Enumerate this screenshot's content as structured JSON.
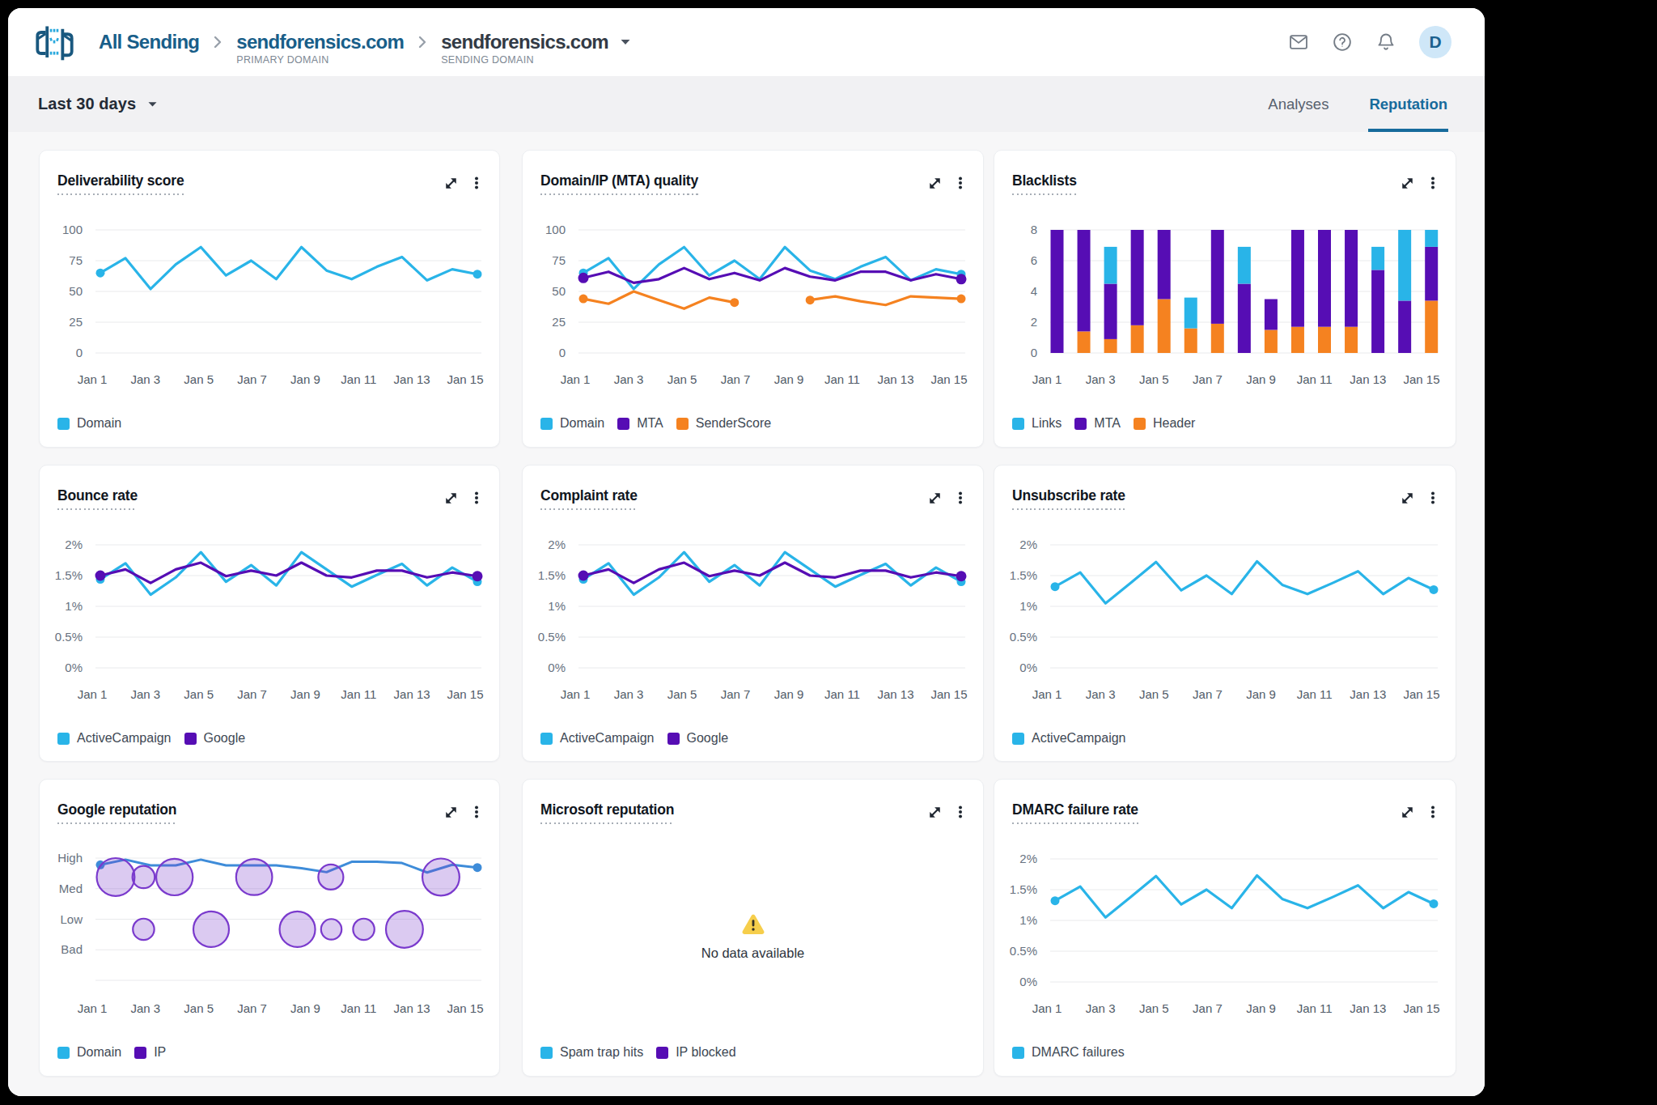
{
  "header": {
    "breadcrumb": [
      {
        "label": "All Sending",
        "sublabel": ""
      },
      {
        "label": "sendforensics.com",
        "sublabel": "PRIMARY DOMAIN"
      },
      {
        "label": "sendforensics.com",
        "sublabel": "SENDING DOMAIN"
      }
    ],
    "avatar_letter": "D"
  },
  "toolbar": {
    "date_range_label": "Last 30 days",
    "tabs": [
      {
        "label": "Analyses",
        "active": false
      },
      {
        "label": "Reputation",
        "active": true
      }
    ]
  },
  "colors": {
    "cyan": "#29B4E8",
    "purple": "#560DB4",
    "orange": "#F58220",
    "blue": "#3E8CD9",
    "bubble_stroke": "#7A3ACD",
    "brand_dark": "#185E89",
    "brand_light": "#29A9DE",
    "warn_yellow": "#F6CE4B",
    "warn_dark": "#353025",
    "tab_active": "#176B9C"
  },
  "x_tick_labels": [
    "Jan 1",
    "Jan 3",
    "Jan 5",
    "Jan 7",
    "Jan 9",
    "Jan 11",
    "Jan 13",
    "Jan 15"
  ],
  "chart_data": [
    {
      "title": "Deliverability score",
      "type": "line",
      "y_ticks": [
        "100",
        "75",
        "50",
        "25",
        "0"
      ],
      "y_max": 100,
      "series": [
        {
          "name": "Domain",
          "color": "cyan",
          "markers": "ends",
          "values": [
            65,
            77,
            52,
            72,
            86,
            63,
            75,
            60,
            86,
            67,
            60,
            70,
            78,
            59,
            68,
            64
          ]
        }
      ],
      "legend": [
        {
          "label": "Domain",
          "color": "cyan"
        }
      ]
    },
    {
      "title": "Domain/IP (MTA) quality",
      "type": "line",
      "y_ticks": [
        "100",
        "75",
        "50",
        "25",
        "0"
      ],
      "y_max": 100,
      "series": [
        {
          "name": "Domain",
          "color": "cyan",
          "markers": "ends",
          "values": [
            65,
            77,
            52,
            72,
            86,
            63,
            75,
            60,
            86,
            67,
            60,
            70,
            78,
            59,
            68,
            64
          ]
        },
        {
          "name": "MTA",
          "color": "purple",
          "markers": "ends",
          "values": [
            61,
            66,
            57,
            60,
            69,
            60,
            65,
            59,
            69,
            62,
            59,
            66,
            66,
            59,
            64,
            60
          ]
        },
        {
          "name": "SenderScore",
          "color": "orange",
          "markers": "segment-ends",
          "values": [
            44,
            40,
            50,
            43,
            36,
            45,
            41,
            null,
            null,
            43,
            46,
            42,
            39,
            46,
            45,
            44
          ]
        }
      ],
      "legend": [
        {
          "label": "Domain",
          "color": "cyan"
        },
        {
          "label": "MTA",
          "color": "purple"
        },
        {
          "label": "SenderScore",
          "color": "orange"
        }
      ]
    },
    {
      "title": "Blacklists",
      "type": "stacked-bar",
      "y_ticks": [
        "8",
        "6",
        "4",
        "2",
        "0"
      ],
      "y_max": 8,
      "stacks": [
        {
          "name": "Header",
          "color": "orange",
          "values": [
            0,
            1.4,
            0.9,
            1.8,
            3.5,
            1.6,
            1.9,
            0,
            1.5,
            1.7,
            1.7,
            1.7,
            0,
            0,
            3.4
          ]
        },
        {
          "name": "MTA",
          "color": "purple",
          "values": [
            8,
            6.6,
            3.6,
            6.2,
            4.5,
            0,
            6.1,
            4.5,
            2.0,
            6.3,
            6.3,
            6.3,
            5.4,
            3.4,
            3.5
          ]
        },
        {
          "name": "Links",
          "color": "cyan",
          "values": [
            0,
            0,
            2.4,
            0,
            0,
            2.0,
            0,
            2.4,
            0,
            0,
            0,
            0,
            1.5,
            4.6,
            1.1
          ]
        }
      ],
      "legend": [
        {
          "label": "Links",
          "color": "cyan"
        },
        {
          "label": "MTA",
          "color": "purple"
        },
        {
          "label": "Header",
          "color": "orange"
        }
      ]
    },
    {
      "title": "Bounce rate",
      "type": "line",
      "y_ticks": [
        "2%",
        "1.5%",
        "1%",
        "0.5%",
        "0%"
      ],
      "y_max": 2,
      "series": [
        {
          "name": "ActiveCampaign",
          "color": "cyan",
          "markers": "ends",
          "values": [
            1.44,
            1.7,
            1.19,
            1.47,
            1.88,
            1.4,
            1.67,
            1.34,
            1.88,
            1.6,
            1.32,
            1.51,
            1.69,
            1.34,
            1.63,
            1.4
          ]
        },
        {
          "name": "Google",
          "color": "purple",
          "markers": "ends",
          "values": [
            1.5,
            1.6,
            1.38,
            1.6,
            1.71,
            1.49,
            1.58,
            1.5,
            1.71,
            1.5,
            1.47,
            1.58,
            1.58,
            1.47,
            1.55,
            1.49
          ]
        }
      ],
      "legend": [
        {
          "label": "ActiveCampaign",
          "color": "cyan"
        },
        {
          "label": "Google",
          "color": "purple"
        }
      ]
    },
    {
      "title": "Complaint rate",
      "type": "line",
      "y_ticks": [
        "2%",
        "1.5%",
        "1%",
        "0.5%",
        "0%"
      ],
      "y_max": 2,
      "series": [
        {
          "name": "ActiveCampaign",
          "color": "cyan",
          "markers": "ends",
          "values": [
            1.44,
            1.7,
            1.19,
            1.47,
            1.88,
            1.4,
            1.67,
            1.34,
            1.88,
            1.6,
            1.32,
            1.51,
            1.69,
            1.34,
            1.63,
            1.4
          ]
        },
        {
          "name": "Google",
          "color": "purple",
          "markers": "ends",
          "values": [
            1.5,
            1.6,
            1.38,
            1.6,
            1.71,
            1.49,
            1.58,
            1.5,
            1.71,
            1.5,
            1.47,
            1.58,
            1.58,
            1.47,
            1.55,
            1.49
          ]
        }
      ],
      "legend": [
        {
          "label": "ActiveCampaign",
          "color": "cyan"
        },
        {
          "label": "Google",
          "color": "purple"
        }
      ]
    },
    {
      "title": "Unsubscribe rate",
      "type": "line",
      "y_ticks": [
        "2%",
        "1.5%",
        "1%",
        "0.5%",
        "0%"
      ],
      "y_max": 2,
      "series": [
        {
          "name": "ActiveCampaign",
          "color": "cyan",
          "markers": "ends",
          "values": [
            1.32,
            1.55,
            1.05,
            1.38,
            1.72,
            1.26,
            1.5,
            1.2,
            1.73,
            1.35,
            1.2,
            1.38,
            1.57,
            1.2,
            1.46,
            1.27
          ]
        }
      ],
      "legend": [
        {
          "label": "ActiveCampaign",
          "color": "cyan"
        }
      ]
    },
    {
      "title": "Google reputation",
      "type": "bubble-line",
      "y_ticks": [
        "High",
        "Med",
        "Low",
        "Bad",
        ""
      ],
      "line": {
        "name": "Domain",
        "color": "blue",
        "values": [
          2.78,
          2.95,
          2.76,
          2.76,
          2.95,
          2.76,
          2.76,
          2.76,
          2.67,
          2.54,
          2.88,
          2.88,
          2.84,
          2.53,
          2.78,
          2.69
        ]
      },
      "bubbles": {
        "name": "IP",
        "points": [
          {
            "d": 0.61,
            "v": 2.38,
            "r": 23.4
          },
          {
            "d": 1.72,
            "v": 2.38,
            "r": 13.8
          },
          {
            "d": 2.95,
            "v": 2.38,
            "r": 22.6
          },
          {
            "d": 6.12,
            "v": 2.38,
            "r": 22.3
          },
          {
            "d": 9.17,
            "v": 2.38,
            "r": 15.5
          },
          {
            "d": 13.55,
            "v": 2.38,
            "r": 22.9
          },
          {
            "d": 1.72,
            "v": 0.67,
            "r": 13.2
          },
          {
            "d": 4.41,
            "v": 0.67,
            "r": 22.0
          },
          {
            "d": 7.84,
            "v": 0.67,
            "r": 22.0
          },
          {
            "d": 9.19,
            "v": 0.67,
            "r": 12.7
          },
          {
            "d": 10.48,
            "v": 0.67,
            "r": 13.2
          },
          {
            "d": 12.1,
            "v": 0.67,
            "r": 22.9
          }
        ]
      },
      "legend": [
        {
          "label": "Domain",
          "color": "cyan"
        },
        {
          "label": "IP",
          "color": "purple"
        }
      ]
    },
    {
      "title": "Microsoft reputation",
      "type": "empty",
      "empty_text": "No data available",
      "legend": [
        {
          "label": "Spam trap hits",
          "color": "cyan"
        },
        {
          "label": "IP blocked",
          "color": "purple"
        }
      ]
    },
    {
      "title": "DMARC failure rate",
      "type": "line",
      "y_ticks": [
        "2%",
        "1.5%",
        "1%",
        "0.5%",
        "0%"
      ],
      "y_max": 2,
      "series": [
        {
          "name": "DMARC failures",
          "color": "cyan",
          "markers": "ends",
          "values": [
            1.32,
            1.55,
            1.05,
            1.38,
            1.72,
            1.26,
            1.5,
            1.2,
            1.73,
            1.35,
            1.2,
            1.38,
            1.57,
            1.2,
            1.46,
            1.27
          ]
        }
      ],
      "legend": [
        {
          "label": "DMARC failures",
          "color": "cyan"
        }
      ]
    }
  ]
}
